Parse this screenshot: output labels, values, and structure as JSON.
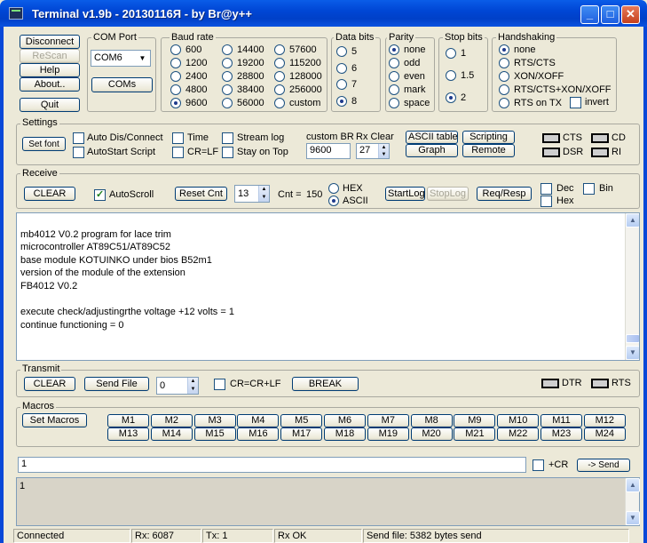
{
  "window": {
    "title": "Terminal v1.9b - 20130116Я - by Br@y++",
    "minimize": "_",
    "maximize": "□",
    "close": "✕"
  },
  "left_buttons": {
    "disconnect": "Disconnect",
    "rescan": "ReScan",
    "help": "Help",
    "about": "About..",
    "quit": "Quit"
  },
  "com_port": {
    "label": "COM Port",
    "value": "COM6",
    "coms_button": "COMs"
  },
  "baud_rate": {
    "label": "Baud rate",
    "options": [
      "600",
      "1200",
      "2400",
      "4800",
      "9600",
      "14400",
      "19200",
      "28800",
      "38400",
      "56000",
      "57600",
      "115200",
      "128000",
      "256000",
      "custom"
    ],
    "selected": "9600"
  },
  "data_bits": {
    "label": "Data bits",
    "options": [
      "5",
      "6",
      "7",
      "8"
    ],
    "selected": "8"
  },
  "parity": {
    "label": "Parity",
    "options": [
      "none",
      "odd",
      "even",
      "mark",
      "space"
    ],
    "selected": "none"
  },
  "stop_bits": {
    "label": "Stop bits",
    "options": [
      "1",
      "1.5",
      "2"
    ],
    "selected": "2"
  },
  "handshaking": {
    "label": "Handshaking",
    "options": [
      "none",
      "RTS/CTS",
      "XON/XOFF",
      "RTS/CTS+XON/XOFF",
      "RTS on TX"
    ],
    "selected": "none",
    "invert_label": "invert"
  },
  "settings": {
    "label": "Settings",
    "set_font": "Set font",
    "auto_dis_connect": "Auto Dis/Connect",
    "autostart_script": "AutoStart Script",
    "time": "Time",
    "cr_lf": "CR=LF",
    "stream_log": "Stream log",
    "stay_on_top": "Stay on Top",
    "custom_br_label": "custom BR",
    "custom_br_value": "9600",
    "rx_clear_label": "Rx Clear",
    "rx_clear_value": "27",
    "ascii_table": "ASCII table",
    "graph": "Graph",
    "scripting": "Scripting",
    "remote": "Remote",
    "leds": {
      "cts": "CTS",
      "cd": "CD",
      "dsr": "DSR",
      "ri": "RI"
    }
  },
  "receive": {
    "label": "Receive",
    "clear": "CLEAR",
    "autoscroll": "AutoScroll",
    "reset_cnt": "Reset Cnt",
    "cnt_spin": "13",
    "cnt_label": "Cnt =",
    "cnt_value": "150",
    "hex": "HEX",
    "ascii": "ASCII",
    "startlog": "StartLog",
    "stoplog": "StopLog",
    "req_resp": "Req/Resp",
    "dec": "Dec",
    "hex_chk": "Hex",
    "bin": "Bin",
    "lines": [
      "",
      "mb4012 V0.2 program for lace trim",
      "microcontroller AT89C51/AT89C52",
      "base module KOTUINKO under bios B52m1",
      "version of the module of the extension",
      "FB4012 V0.2",
      "",
      "execute check/adjustingrthe voltage +12 volts = 1",
      "continue functioning = 0"
    ]
  },
  "transmit": {
    "label": "Transmit",
    "clear": "CLEAR",
    "send_file": "Send File",
    "spin_value": "0",
    "cr_crlf": "CR=CR+LF",
    "break": "BREAK",
    "dtr": "DTR",
    "rts": "RTS"
  },
  "macros": {
    "label": "Macros",
    "set_macros": "Set Macros",
    "row1": [
      "M1",
      "M2",
      "M3",
      "M4",
      "M5",
      "M6",
      "M7",
      "M8",
      "M9",
      "M10",
      "M11",
      "M12"
    ],
    "row2": [
      "M13",
      "M14",
      "M15",
      "M16",
      "M17",
      "M18",
      "M19",
      "M20",
      "M21",
      "M22",
      "M23",
      "M24"
    ]
  },
  "send": {
    "input_value": "1",
    "plus_cr": "+CR",
    "send_button": "-> Send",
    "echo_text": "1"
  },
  "status_bar": {
    "connected": "Connected",
    "rx": "Rx: 6087",
    "tx": "Tx: 1",
    "rx_ok": "Rx OK",
    "send_file": "Send file: 5382 bytes send"
  },
  "colors": {
    "titlebar": "#0046d5",
    "window_bg": "#ece9d8",
    "terminal_bg": "#ffffff",
    "echo_bg": "#d8d4c8"
  }
}
